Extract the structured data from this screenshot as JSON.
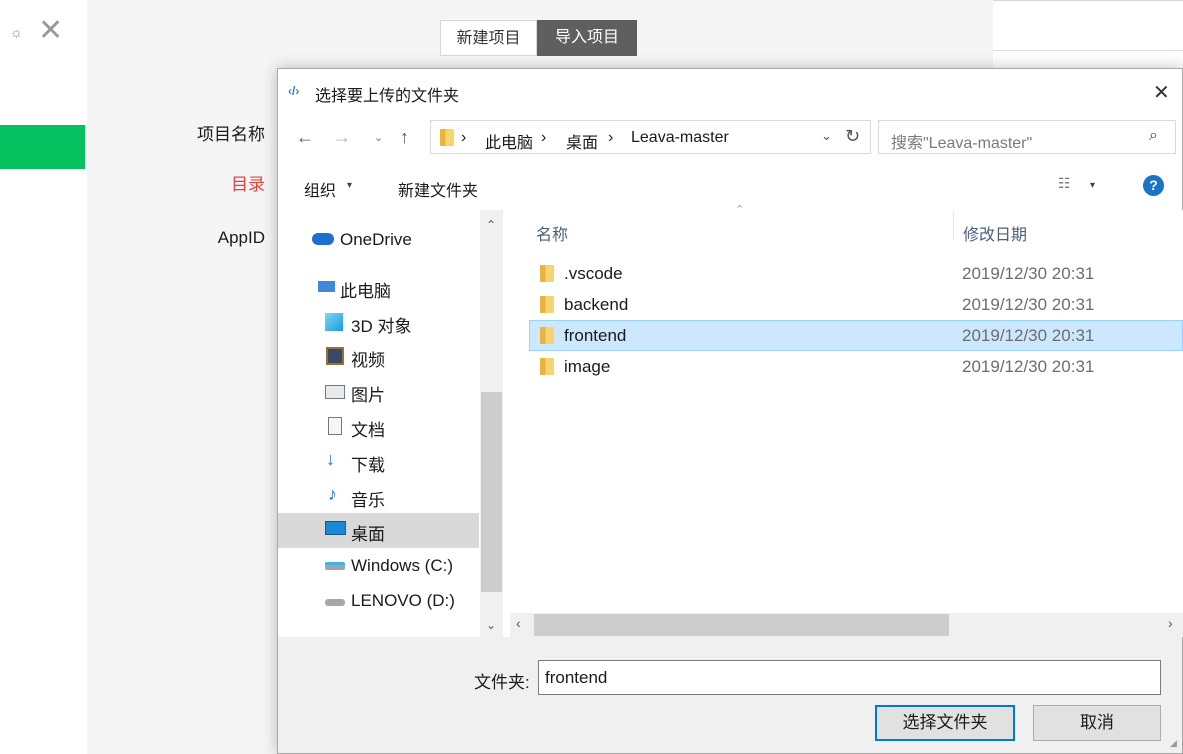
{
  "background_app": {
    "segments": {
      "new_project": "新建项目",
      "import_project": "导入项目"
    },
    "form": {
      "project_name": "项目名称",
      "directory": "目录",
      "appid": "AppID"
    },
    "colors": {
      "accent_green": "#07c160",
      "error_red": "#e64340"
    }
  },
  "dialog": {
    "title": "选择要上传的文件夹",
    "close": "✕",
    "address": {
      "crumbs": [
        "此电脑",
        "桌面",
        "Leava-master"
      ]
    },
    "search": {
      "placeholder": "搜索\"Leava-master\""
    },
    "toolbar": {
      "organize": "组织",
      "new_folder": "新建文件夹",
      "help": "?"
    },
    "nav": {
      "items": [
        {
          "label": "OneDrive",
          "icon": "cloud-icon"
        },
        {
          "label": "此电脑",
          "icon": "computer-icon"
        },
        {
          "label": "3D 对象",
          "icon": "cube-icon"
        },
        {
          "label": "视频",
          "icon": "video-icon"
        },
        {
          "label": "图片",
          "icon": "picture-icon"
        },
        {
          "label": "文档",
          "icon": "document-icon"
        },
        {
          "label": "下载",
          "icon": "download-icon"
        },
        {
          "label": "音乐",
          "icon": "music-icon"
        },
        {
          "label": "桌面",
          "icon": "desktop-icon"
        },
        {
          "label": "Windows (C:)",
          "icon": "drive-icon"
        },
        {
          "label": "LENOVO (D:)",
          "icon": "drive-icon"
        }
      ],
      "selected": "桌面"
    },
    "files": {
      "columns": {
        "name": "名称",
        "modified": "修改日期"
      },
      "rows": [
        {
          "name": ".vscode",
          "date": "2019/12/30 20:31"
        },
        {
          "name": "backend",
          "date": "2019/12/30 20:31"
        },
        {
          "name": "frontend",
          "date": "2019/12/30 20:31",
          "selected": true
        },
        {
          "name": "image",
          "date": "2019/12/30 20:31"
        }
      ]
    },
    "footer": {
      "folder_label": "文件夹:",
      "folder_value": "frontend",
      "select_button": "选择文件夹",
      "cancel_button": "取消"
    }
  }
}
